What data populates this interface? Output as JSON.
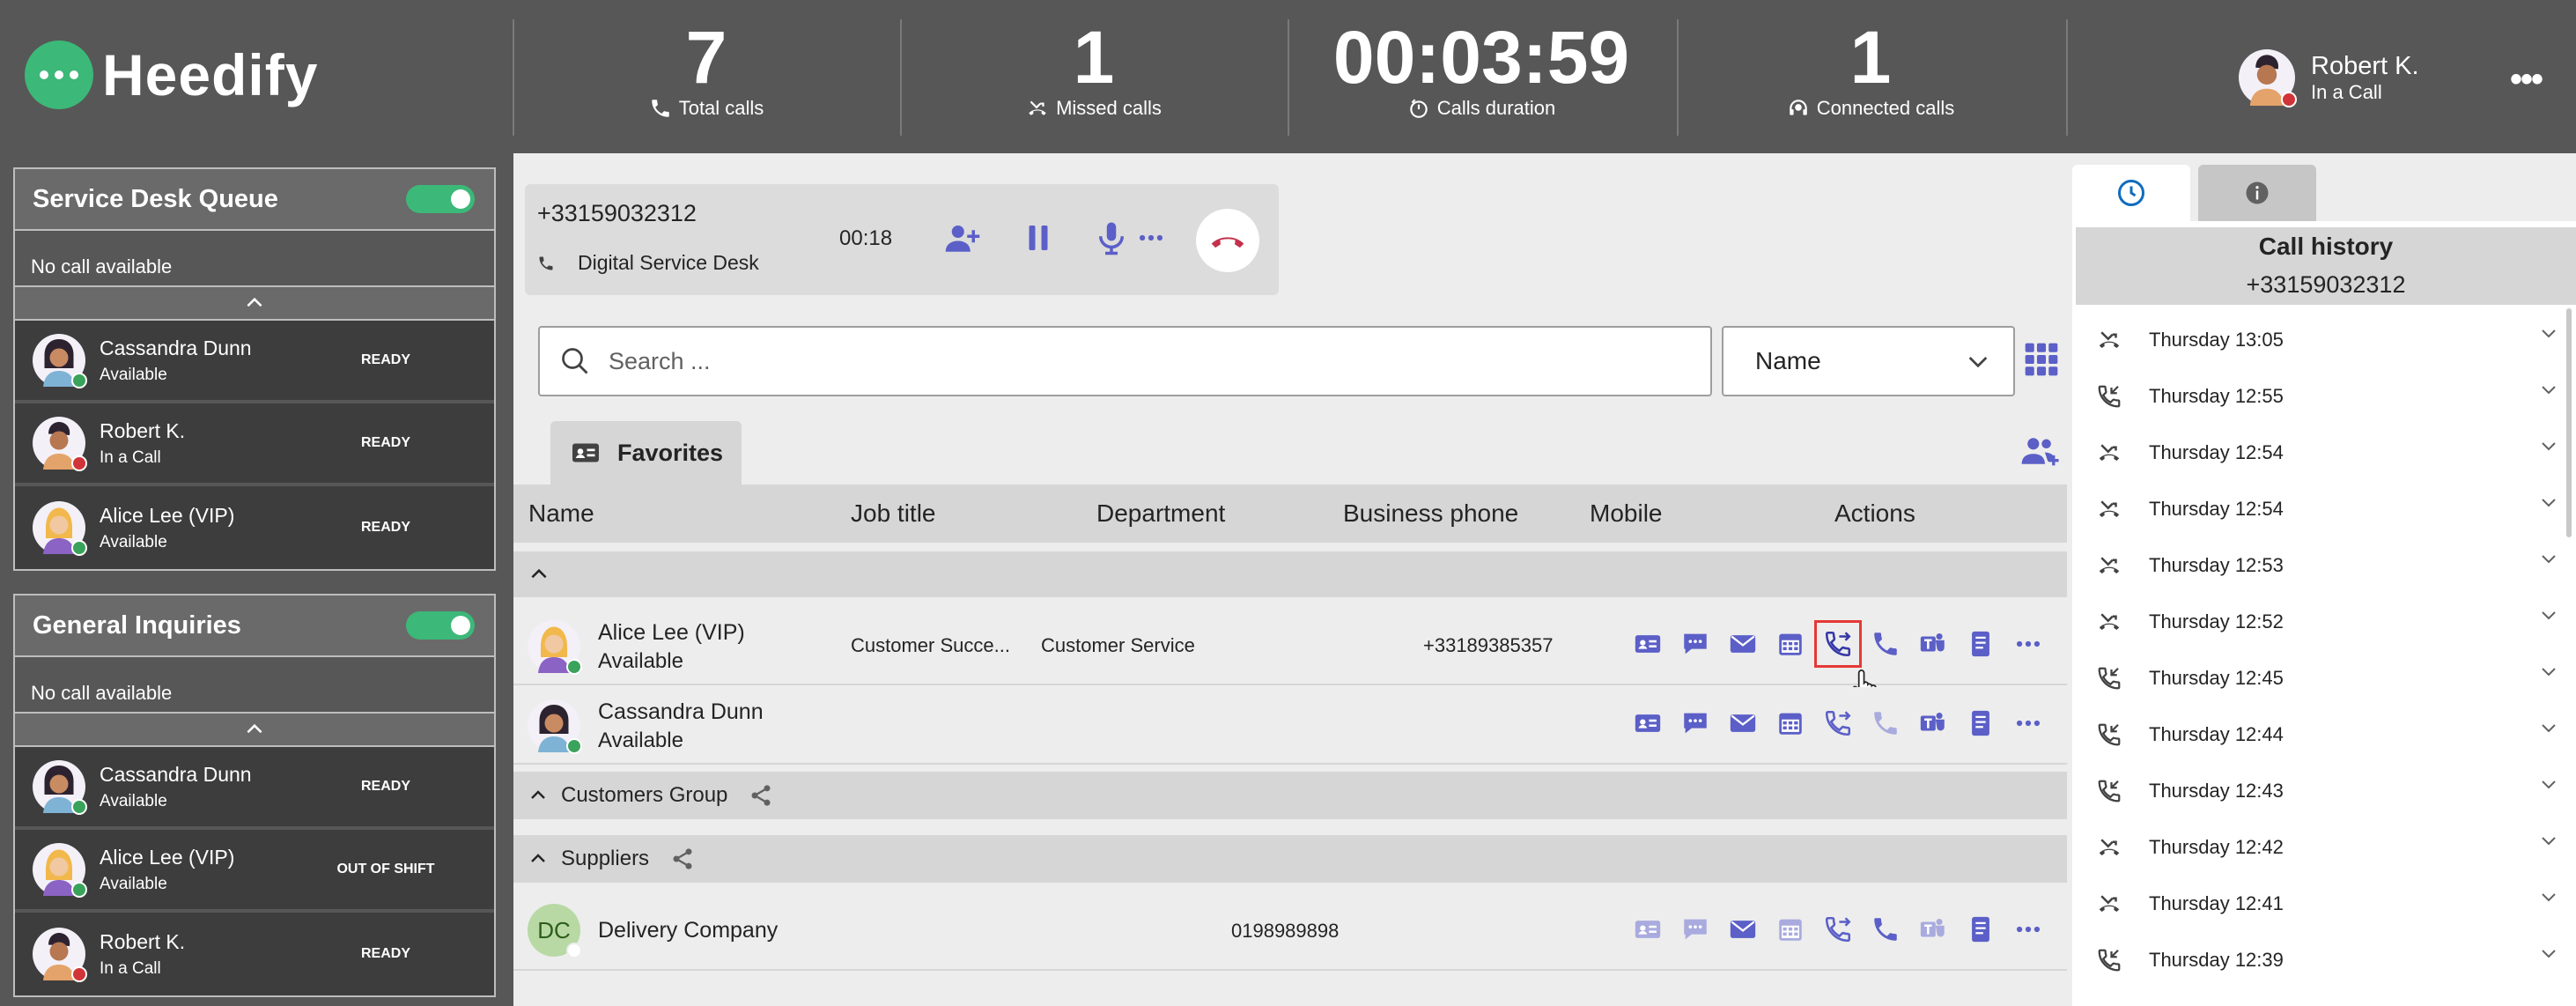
{
  "brand": {
    "name": "Heedify",
    "color": "#3cb878"
  },
  "stats": [
    {
      "value": "7",
      "label": "Total calls",
      "icon": "phone-icon"
    },
    {
      "value": "1",
      "label": "Missed calls",
      "icon": "missed-call-icon"
    },
    {
      "value": "00:03:59",
      "label": "Calls duration",
      "icon": "timer-icon"
    },
    {
      "value": "1",
      "label": "Connected calls",
      "icon": "headset-icon"
    }
  ],
  "user": {
    "name": "Robert K.",
    "status": "In a Call"
  },
  "queues": [
    {
      "title": "Service Desk Queue",
      "enabled": true,
      "empty": "No call available",
      "agents": [
        {
          "name": "Cassandra Dunn",
          "status": "Available",
          "tag": "READY"
        },
        {
          "name": "Robert K.",
          "status": "In a Call",
          "tag": "READY"
        },
        {
          "name": "Alice Lee (VIP)",
          "status": "Available",
          "tag": "READY"
        }
      ]
    },
    {
      "title": "General Inquiries",
      "enabled": true,
      "empty": "No call available",
      "agents": [
        {
          "name": "Cassandra Dunn",
          "status": "Available",
          "tag": "READY"
        },
        {
          "name": "Alice Lee (VIP)",
          "status": "Available",
          "tag": "OUT OF SHIFT"
        },
        {
          "name": "Robert K.",
          "status": "In a Call",
          "tag": "READY"
        }
      ]
    }
  ],
  "active_call": {
    "number": "+33159032312",
    "line": "Digital Service Desk",
    "timer": "00:18"
  },
  "search": {
    "placeholder": "Search ..."
  },
  "sort": {
    "selected": "Name"
  },
  "tabs": {
    "favorites": "Favorites"
  },
  "columns": [
    "Name",
    "Job title",
    "Department",
    "Business phone",
    "Mobile",
    "Actions"
  ],
  "contacts": [
    {
      "name": "Alice Lee (VIP)",
      "status": "Available",
      "job": "Customer Succe...",
      "dept": "Customer Service",
      "phone": "+33189385357"
    },
    {
      "name": "Cassandra Dunn",
      "status": "Available",
      "job": "",
      "dept": "",
      "phone": ""
    }
  ],
  "groups": [
    {
      "name": "Customers Group"
    },
    {
      "name": "Suppliers"
    }
  ],
  "supplier": {
    "initials": "DC",
    "name": "Delivery Company",
    "phone": "0198989898"
  },
  "history": {
    "title": "Call history",
    "number": "+33159032312",
    "items": [
      {
        "label": "Thursday 13:05",
        "type": "missed"
      },
      {
        "label": "Thursday 12:55",
        "type": "incoming"
      },
      {
        "label": "Thursday 12:54",
        "type": "missed"
      },
      {
        "label": "Thursday 12:54",
        "type": "missed"
      },
      {
        "label": "Thursday 12:53",
        "type": "missed"
      },
      {
        "label": "Thursday 12:52",
        "type": "missed"
      },
      {
        "label": "Thursday 12:45",
        "type": "incoming"
      },
      {
        "label": "Thursday 12:44",
        "type": "incoming"
      },
      {
        "label": "Thursday 12:43",
        "type": "incoming"
      },
      {
        "label": "Thursday 12:42",
        "type": "missed"
      },
      {
        "label": "Thursday 12:41",
        "type": "missed"
      },
      {
        "label": "Thursday 12:39",
        "type": "incoming"
      }
    ]
  },
  "colors": {
    "accent": "#5b5fc7",
    "topbar": "#575757",
    "hangup": "#c4314b"
  }
}
